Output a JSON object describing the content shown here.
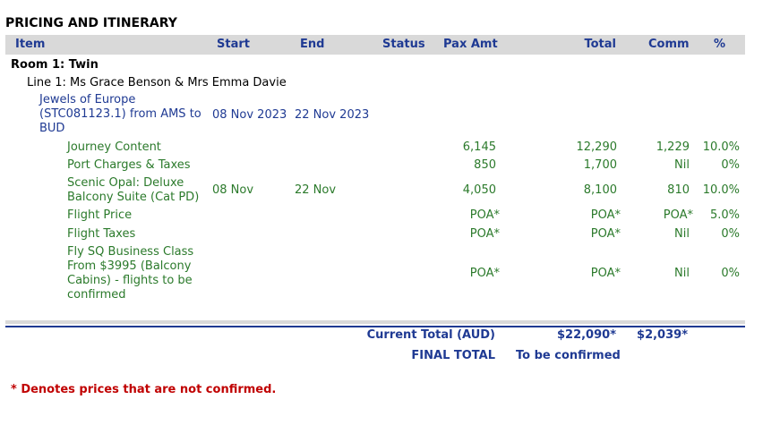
{
  "section_title": "PRICING AND ITINERARY",
  "columns": {
    "item": "Item",
    "start": "Start",
    "end": "End",
    "status": "Status",
    "pax_amt": "Pax Amt",
    "total": "Total",
    "comm": "Comm",
    "pct": "%"
  },
  "room": "Room 1: Twin",
  "line": "Line 1: Ms Grace Benson & Mrs Emma Davie",
  "tour": {
    "name": "Jewels of Europe (STC081123.1) from AMS to BUD",
    "start": "08 Nov 2023",
    "end": "22 Nov 2023"
  },
  "rows": [
    {
      "item": "Journey Content",
      "start": "",
      "end": "",
      "status": "",
      "pax_amt": "6,145",
      "total": "12,290",
      "comm": "1,229",
      "pct": "10.0%"
    },
    {
      "item": "Port Charges & Taxes",
      "start": "",
      "end": "",
      "status": "",
      "pax_amt": "850",
      "total": "1,700",
      "comm": "Nil",
      "pct": "0%"
    },
    {
      "item": "Scenic Opal: Deluxe Balcony Suite (Cat PD)",
      "start": "08 Nov",
      "end": "22 Nov",
      "status": "",
      "pax_amt": "4,050",
      "total": "8,100",
      "comm": "810",
      "pct": "10.0%"
    },
    {
      "item": "Flight Price",
      "start": "",
      "end": "",
      "status": "",
      "pax_amt": "POA*",
      "total": "POA*",
      "comm": "POA*",
      "pct": "5.0%"
    },
    {
      "item": "Flight Taxes",
      "start": "",
      "end": "",
      "status": "",
      "pax_amt": "POA*",
      "total": "POA*",
      "comm": "Nil",
      "pct": "0%"
    },
    {
      "item": "Fly SQ Business Class From $3995 (Balcony Cabins) - flights to be confirmed",
      "start": "",
      "end": "",
      "status": "",
      "pax_amt": "POA*",
      "total": "POA*",
      "comm": "Nil",
      "pct": "0%"
    }
  ],
  "totals": {
    "current_label": "Current Total (AUD)",
    "current_total": "$22,090*",
    "current_comm": "$2,039*",
    "final_label": "FINAL TOTAL",
    "final_value": "To be confirmed"
  },
  "footnote": "* Denotes prices that are not confirmed."
}
